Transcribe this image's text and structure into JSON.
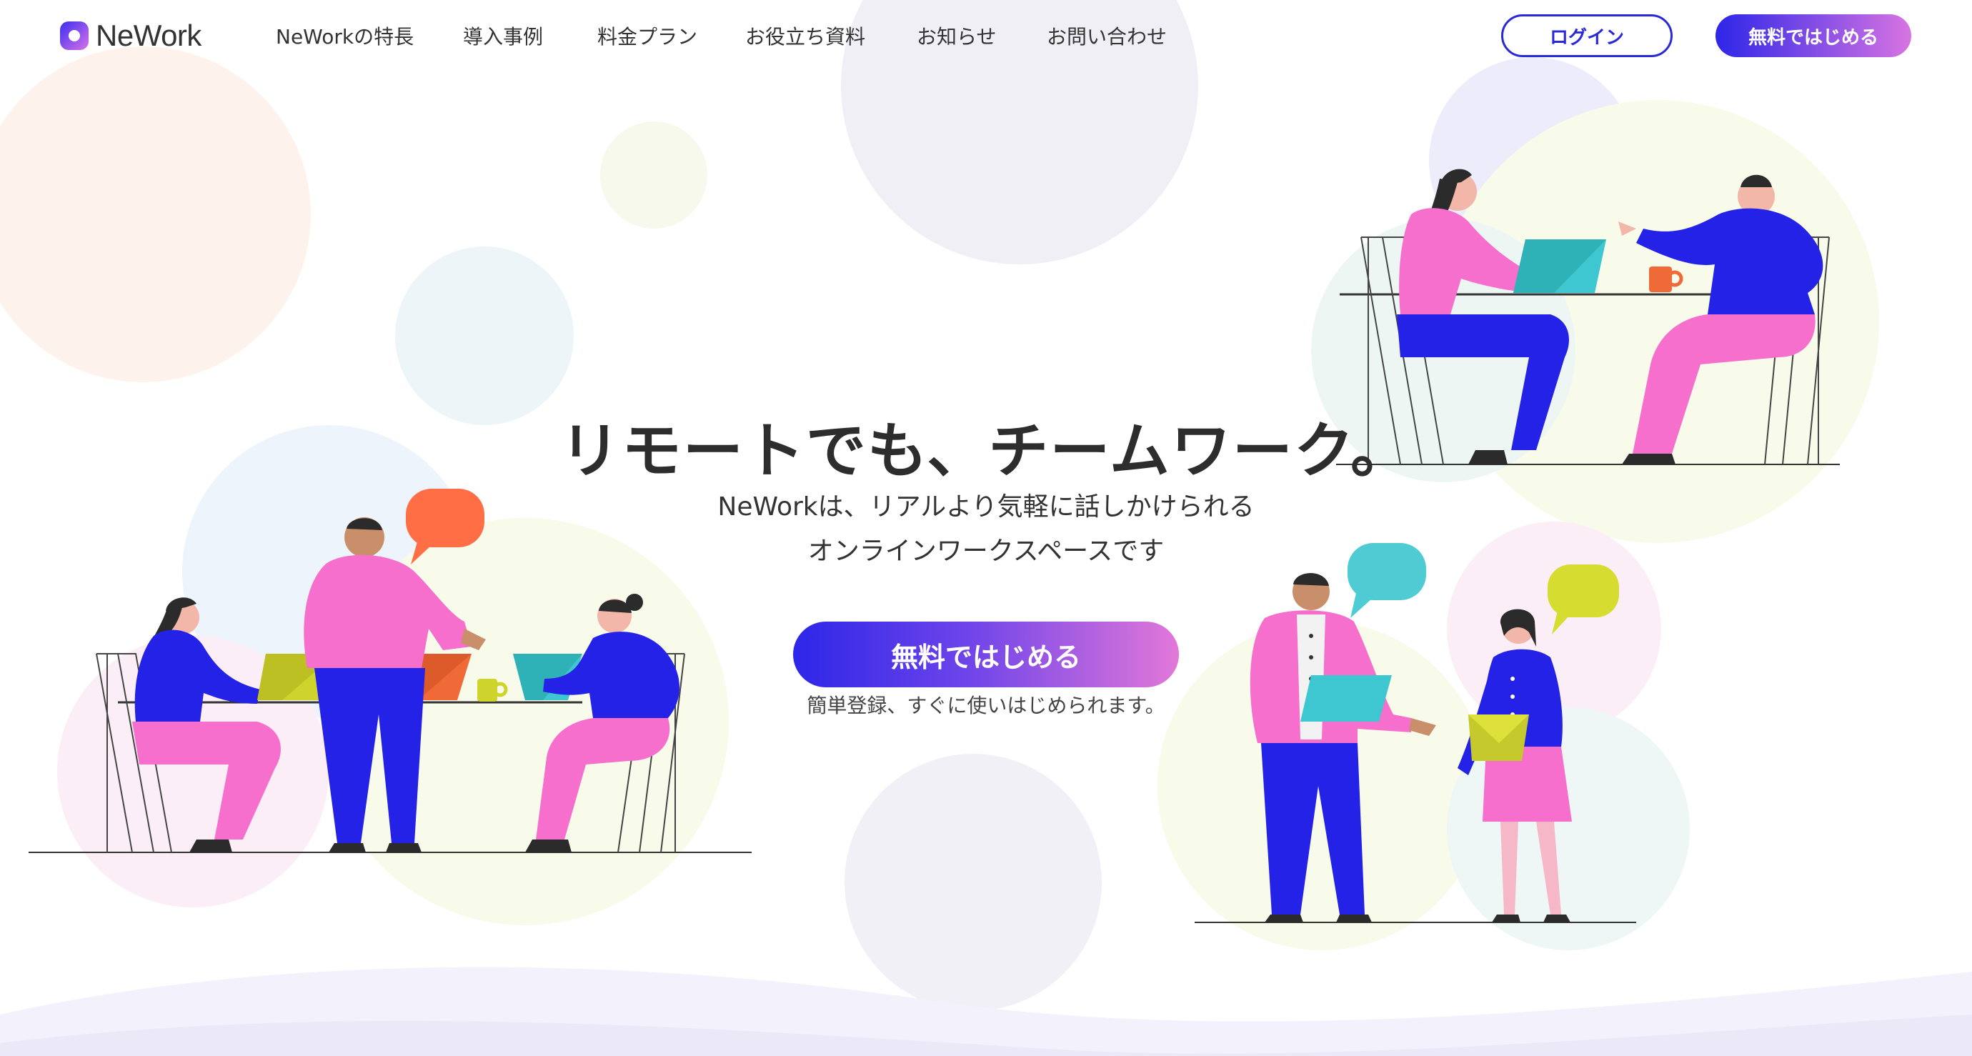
{
  "brand": {
    "logo_text": "NeWork",
    "accent": "#2a28d8",
    "gradient_start": "#2d26e8",
    "gradient_end": "#e278d8"
  },
  "nav": {
    "items": [
      {
        "label": "NeWorkの特長"
      },
      {
        "label": "導入事例"
      },
      {
        "label": "料金プラン"
      },
      {
        "label": "お役立ち資料"
      },
      {
        "label": "お知らせ"
      },
      {
        "label": "お問い合わせ"
      }
    ],
    "login_label": "ログイン",
    "start_label": "無料ではじめる"
  },
  "hero": {
    "title": "リモートでも、チームワーク。",
    "subtitle_line1": "NeWorkは、リアルより気軽に話しかけられる",
    "subtitle_line2": "オンラインワークスペースです",
    "cta_label": "無料ではじめる",
    "cta_note": "簡単登録、すぐに使いはじめられます。"
  },
  "icons": [
    "logo-icon",
    "speech-bubble-icon",
    "laptop-icon",
    "mug-icon"
  ]
}
